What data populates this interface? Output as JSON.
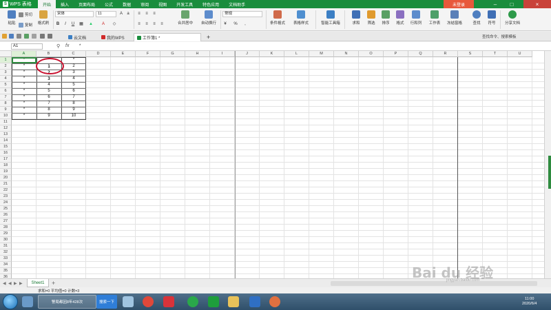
{
  "app": {
    "name": "WPS 表格",
    "menu_tabs": [
      "开始",
      "插入",
      "页面布局",
      "公式",
      "数据",
      "审阅",
      "视图",
      "开发工具",
      "特色应用",
      "文档助手"
    ],
    "active_tab": "开始",
    "login": "未登录",
    "accent_color": "#1a8d3d"
  },
  "ribbon": {
    "paste": "粘贴",
    "cut": "剪切",
    "copy": "复制",
    "format_painter": "格式刷",
    "font_name": "宋体",
    "font_size": "11",
    "merge_center": "合并居中",
    "wrap_text": "自动换行",
    "number_format": "常规",
    "cond_format": "条件格式",
    "table_style": "表格样式",
    "smart_toolbox": "智能工具箱",
    "sum": "求和",
    "filter": "筛选",
    "sort": "排序",
    "format": "格式",
    "row_col": "行和列",
    "worksheet": "工作表",
    "freeze": "冻结窗格",
    "find": "查找",
    "symbol": "符号",
    "share": "分享文档",
    "percent": "%"
  },
  "tabs": {
    "cloud": "云文档",
    "my_wps": "我的WPS",
    "workbook": "工作簿1 *",
    "search_cmd": "查找命令、搜索模板"
  },
  "formula_bar": {
    "cell_ref": "A1",
    "fx": "fx",
    "content": "*"
  },
  "grid": {
    "columns": [
      "A",
      "B",
      "C",
      "D",
      "E",
      "F",
      "G",
      "H",
      "I",
      "J",
      "K",
      "L",
      "M",
      "N",
      "O",
      "P",
      "Q",
      "R",
      "S",
      "T",
      "U"
    ],
    "row_count": 36,
    "data": [
      [
        "*",
        "*",
        "*"
      ],
      [
        "*",
        "1",
        "2"
      ],
      [
        "*",
        "2",
        "3"
      ],
      [
        "*",
        "3",
        "4"
      ],
      [
        "*",
        "4",
        "5"
      ],
      [
        "*",
        "5",
        "6"
      ],
      [
        "*",
        "6",
        "7"
      ],
      [
        "*",
        "7",
        "8"
      ],
      [
        "*",
        "8",
        "9"
      ],
      [
        "*",
        "9",
        "10"
      ]
    ]
  },
  "sheet": {
    "tab": "Sheet1",
    "add": "+"
  },
  "status": {
    "text": "求和=0  平均值=0  计数=3"
  },
  "taskbar": {
    "ie_label": "警局都因8年428次",
    "search_btn": "搜索一下",
    "time": "11:00",
    "date": "2020/6/4"
  },
  "watermark": {
    "text": "Bai du 经验",
    "url": "jingyan.baidu.com"
  }
}
